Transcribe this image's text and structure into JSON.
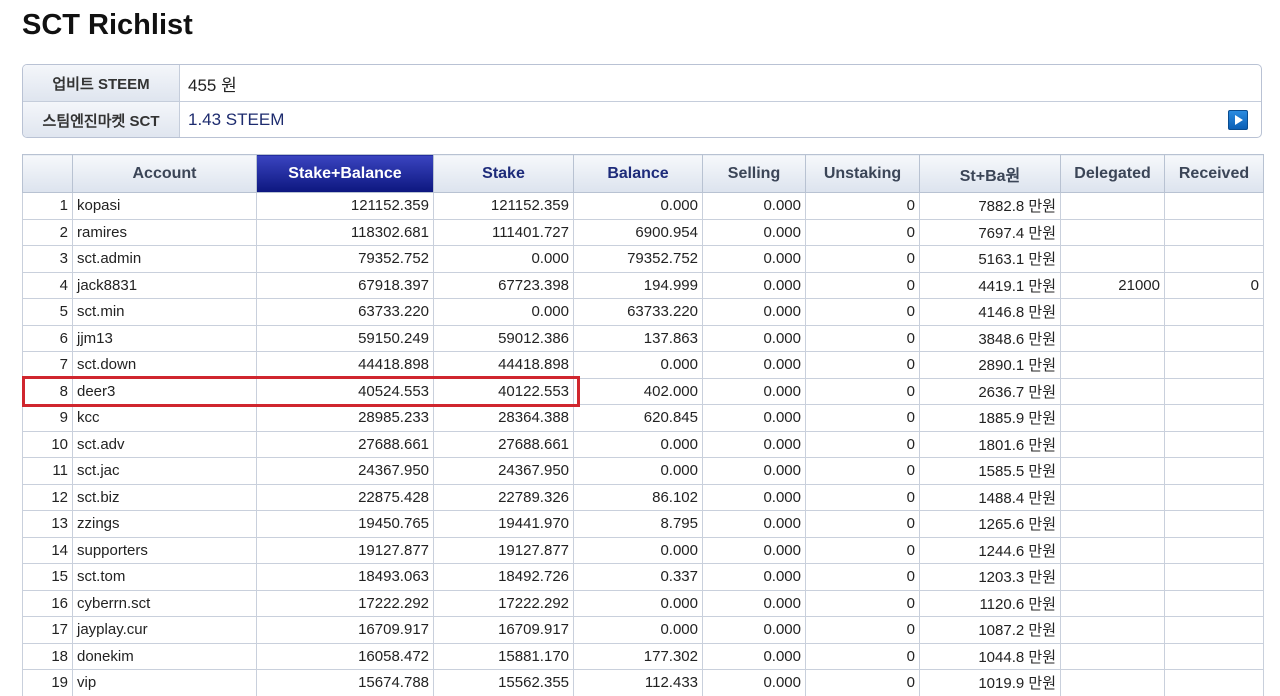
{
  "title": "SCT Richlist",
  "prices": [
    {
      "label": "업비트 STEEM",
      "value": "455 원"
    },
    {
      "label": "스팀엔진마켓 SCT",
      "value": "1.43 STEEM"
    }
  ],
  "columns": [
    "",
    "Account",
    "Stake+Balance",
    "Stake",
    "Balance",
    "Selling",
    "Unstaking",
    "St+Ba원",
    "Delegated",
    "Received"
  ],
  "selected_column": "Stake+Balance",
  "rows": [
    [
      "1",
      "kopasi",
      "121152.359",
      "121152.359",
      "0.000",
      "0.000",
      "0",
      "7882.8 만원",
      "",
      ""
    ],
    [
      "2",
      "ramires",
      "118302.681",
      "111401.727",
      "6900.954",
      "0.000",
      "0",
      "7697.4 만원",
      "",
      ""
    ],
    [
      "3",
      "sct.admin",
      "79352.752",
      "0.000",
      "79352.752",
      "0.000",
      "0",
      "5163.1 만원",
      "",
      ""
    ],
    [
      "4",
      "jack8831",
      "67918.397",
      "67723.398",
      "194.999",
      "0.000",
      "0",
      "4419.1 만원",
      "21000",
      "0"
    ],
    [
      "5",
      "sct.min",
      "63733.220",
      "0.000",
      "63733.220",
      "0.000",
      "0",
      "4146.8 만원",
      "",
      ""
    ],
    [
      "6",
      "jjm13",
      "59150.249",
      "59012.386",
      "137.863",
      "0.000",
      "0",
      "3848.6 만원",
      "",
      ""
    ],
    [
      "7",
      "sct.down",
      "44418.898",
      "44418.898",
      "0.000",
      "0.000",
      "0",
      "2890.1 만원",
      "",
      ""
    ],
    [
      "8",
      "deer3",
      "40524.553",
      "40122.553",
      "402.000",
      "0.000",
      "0",
      "2636.7 만원",
      "",
      ""
    ],
    [
      "9",
      "kcc",
      "28985.233",
      "28364.388",
      "620.845",
      "0.000",
      "0",
      "1885.9 만원",
      "",
      ""
    ],
    [
      "10",
      "sct.adv",
      "27688.661",
      "27688.661",
      "0.000",
      "0.000",
      "0",
      "1801.6 만원",
      "",
      ""
    ],
    [
      "11",
      "sct.jac",
      "24367.950",
      "24367.950",
      "0.000",
      "0.000",
      "0",
      "1585.5 만원",
      "",
      ""
    ],
    [
      "12",
      "sct.biz",
      "22875.428",
      "22789.326",
      "86.102",
      "0.000",
      "0",
      "1488.4 만원",
      "",
      ""
    ],
    [
      "13",
      "zzings",
      "19450.765",
      "19441.970",
      "8.795",
      "0.000",
      "0",
      "1265.6 만원",
      "",
      ""
    ],
    [
      "14",
      "supporters",
      "19127.877",
      "19127.877",
      "0.000",
      "0.000",
      "0",
      "1244.6 만원",
      "",
      ""
    ],
    [
      "15",
      "sct.tom",
      "18493.063",
      "18492.726",
      "0.337",
      "0.000",
      "0",
      "1203.3 만원",
      "",
      ""
    ],
    [
      "16",
      "cyberrn.sct",
      "17222.292",
      "17222.292",
      "0.000",
      "0.000",
      "0",
      "1120.6 만원",
      "",
      ""
    ],
    [
      "17",
      "jayplay.cur",
      "16709.917",
      "16709.917",
      "0.000",
      "0.000",
      "0",
      "1087.2 만원",
      "",
      ""
    ],
    [
      "18",
      "donekim",
      "16058.472",
      "15881.170",
      "177.302",
      "0.000",
      "0",
      "1044.8 만원",
      "",
      ""
    ],
    [
      "19",
      "vip",
      "15674.788",
      "15562.355",
      "112.433",
      "0.000",
      "0",
      "1019.9 만원",
      "",
      ""
    ]
  ],
  "highlight_color": "#d0262e",
  "header_selected_color": "#0c167e",
  "icons": {
    "play": "play-icon"
  }
}
